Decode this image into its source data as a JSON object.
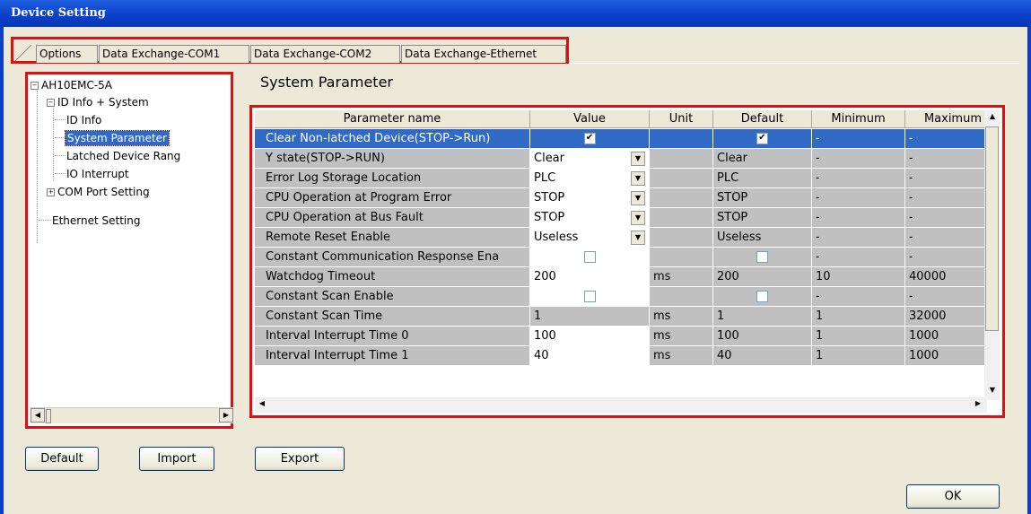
{
  "window": {
    "title": "Device Setting"
  },
  "tabs": [
    "Options",
    "Data Exchange-COM1",
    "Data Exchange-COM2",
    "Data Exchange-Ethernet"
  ],
  "tree": {
    "root": "AH10EMC-5A",
    "id_info_system": "ID Info + System",
    "id_info": "ID Info",
    "system_parameter": "System Parameter",
    "latched_device_range": "Latched Device Rang",
    "io_interrupt": "IO Interrupt",
    "com_port_setting": "COM Port Setting",
    "ethernet_setting": "Ethernet Setting"
  },
  "section_title": "System Parameter",
  "columns": [
    "Parameter name",
    "Value",
    "Unit",
    "Default",
    "Minimum",
    "Maximum"
  ],
  "rows": [
    {
      "name": "Clear Non-latched Device(STOP->Run)",
      "value": "",
      "unit": "",
      "default": "",
      "min": "-",
      "max": "-",
      "value_check": true,
      "default_check": true
    },
    {
      "name": "Y state(STOP->RUN)",
      "value": "Clear",
      "unit": "",
      "default": "Clear",
      "min": "-",
      "max": "-"
    },
    {
      "name": "Error Log Storage Location",
      "value": "PLC",
      "unit": "",
      "default": "PLC",
      "min": "-",
      "max": "-"
    },
    {
      "name": "CPU Operation at Program Error",
      "value": "STOP",
      "unit": "",
      "default": "STOP",
      "min": "-",
      "max": "-"
    },
    {
      "name": "CPU Operation at Bus Fault",
      "value": "STOP",
      "unit": "",
      "default": "STOP",
      "min": "-",
      "max": "-"
    },
    {
      "name": "Remote Reset Enable",
      "value": "Useless",
      "unit": "",
      "default": "Useless",
      "min": "-",
      "max": "-"
    },
    {
      "name": "Constant Communication Response Ena",
      "value": "",
      "unit": "",
      "default": "",
      "min": "-",
      "max": "-",
      "value_check": false,
      "default_check": false
    },
    {
      "name": "Watchdog Timeout",
      "value": "200",
      "unit": "ms",
      "default": "200",
      "min": "10",
      "max": "40000"
    },
    {
      "name": "Constant Scan Enable",
      "value": "",
      "unit": "",
      "default": "",
      "min": "-",
      "max": "-",
      "value_check": false,
      "default_check": false
    },
    {
      "name": "Constant Scan Time",
      "value": "1",
      "unit": "ms",
      "default": "1",
      "min": "1",
      "max": "32000"
    },
    {
      "name": "Interval Interrupt Time 0",
      "value": "100",
      "unit": "ms",
      "default": "100",
      "min": "1",
      "max": "1000"
    },
    {
      "name": "Interval Interrupt Time 1",
      "value": "40",
      "unit": "ms",
      "default": "40",
      "min": "1",
      "max": "1000"
    }
  ],
  "buttons": {
    "default": "Default",
    "import": "Import",
    "export": "Export",
    "ok": "OK"
  }
}
